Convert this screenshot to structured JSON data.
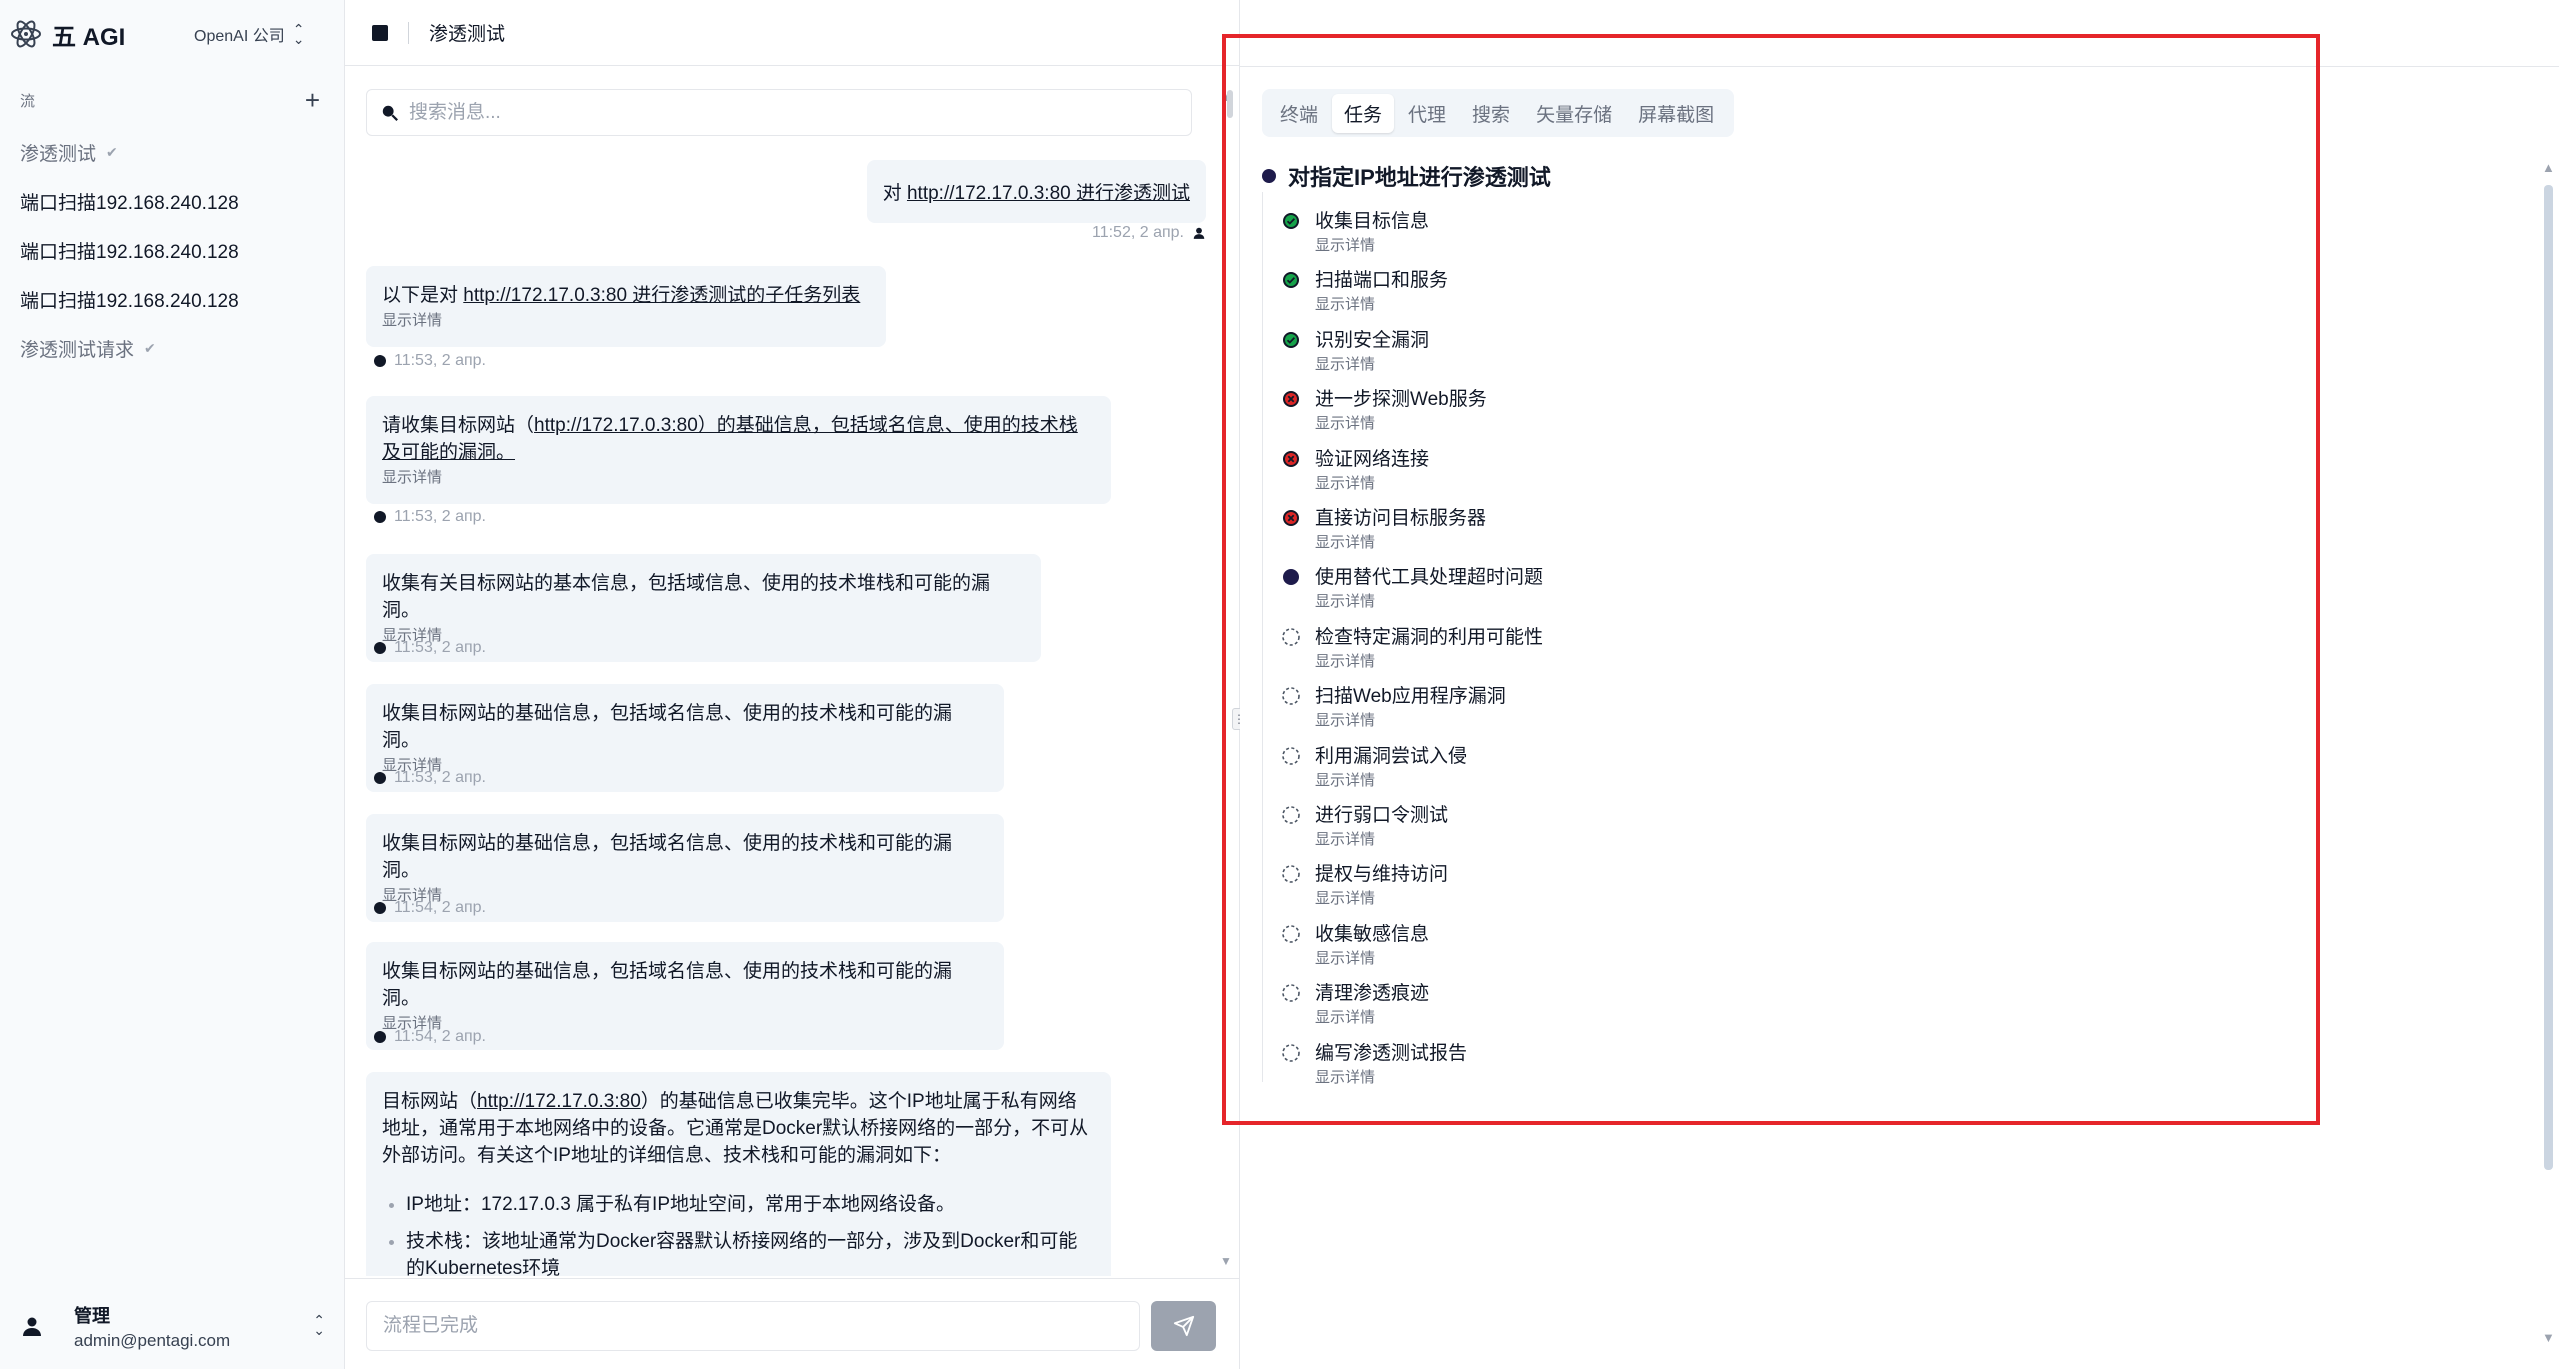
{
  "sidebar": {
    "brand_name": "五 AGI",
    "org_selector": "OpenAI 公司",
    "flows_label": "流",
    "flows": [
      {
        "label": "渗透测试",
        "muted": true
      },
      {
        "label": "端口扫描192.168.240.128",
        "muted": false
      },
      {
        "label": "端口扫描192.168.240.128",
        "muted": false
      },
      {
        "label": "端口扫描192.168.240.128",
        "muted": false
      },
      {
        "label": "渗透测试请求",
        "muted": true
      }
    ],
    "user": {
      "name": "管理",
      "email": "admin@pentagi.com"
    }
  },
  "chat": {
    "title": "渗透测试",
    "search_placeholder": "搜索消息...",
    "user_message": {
      "prefix": "对 ",
      "link": "http://172.17.0.3:80 进行渗透测试",
      "time": "11:52, 2 апр."
    },
    "details_label": "显示详情",
    "messages": [
      {
        "text_prefix": "以下是对 ",
        "link": "http://172.17.0.3:80 进行渗透测试的子任务列表",
        "text_suffix": "",
        "time": "11:53, 2 апр."
      },
      {
        "text_prefix": "请收集目标网站（",
        "link": "http://172.17.0.3:80）的基础信息，包括域名信息、使用的技术栈及可能的漏洞。",
        "text_suffix": "",
        "time": "11:53, 2 апр."
      },
      {
        "text_prefix": "收集有关目标网站的基本信息，包括域信息、使用的技术堆栈和可能的漏洞。",
        "link": "",
        "text_suffix": "",
        "time": "11:53, 2 апр."
      },
      {
        "text_prefix": "收集目标网站的基础信息，包括域名信息、使用的技术栈和可能的漏洞。",
        "link": "",
        "text_suffix": "",
        "time": "11:53, 2 апр."
      },
      {
        "text_prefix": "收集目标网站的基础信息，包括域名信息、使用的技术栈和可能的漏洞。",
        "link": "",
        "text_suffix": "",
        "time": "11:54, 2 апр."
      },
      {
        "text_prefix": "收集目标网站的基础信息，包括域名信息、使用的技术栈和可能的漏洞。",
        "link": "",
        "text_suffix": "",
        "time": "11:54, 2 апр."
      }
    ],
    "final_message": {
      "prefix": "目标网站（",
      "link": "http://172.17.0.3:80",
      "suffix": "）的基础信息已收集完毕。这个IP地址属于私有网络地址，通常用于本地网络中的设备。它通常是Docker默认桥接网络的一部分，不可从外部访问。有关这个IP地址的详细信息、技术栈和可能的漏洞如下：",
      "bullets": [
        "IP地址：172.17.0.3 属于私有IP地址空间，常用于本地网络设备。",
        "技术栈：该地址通常为Docker容器默认桥接网络的一部分，涉及到Docker和可能的Kubernetes环境"
      ]
    },
    "input_placeholder": "流程已完成"
  },
  "right_panel": {
    "tabs": [
      "终端",
      "任务",
      "代理",
      "搜索",
      "矢量存储",
      "屏幕截图"
    ],
    "active_tab": "任务",
    "root_task": "对指定IP地址进行渗透测试",
    "details_label": "显示详情",
    "tasks": [
      {
        "label": "收集目标信息",
        "status": "done"
      },
      {
        "label": "扫描端口和服务",
        "status": "done"
      },
      {
        "label": "识别安全漏洞",
        "status": "done"
      },
      {
        "label": "进一步探测Web服务",
        "status": "failed"
      },
      {
        "label": "验证网络连接",
        "status": "failed"
      },
      {
        "label": "直接访问目标服务器",
        "status": "failed"
      },
      {
        "label": "使用替代工具处理超时问题",
        "status": "running"
      },
      {
        "label": "检查特定漏洞的利用可能性",
        "status": "pending"
      },
      {
        "label": "扫描Web应用程序漏洞",
        "status": "pending"
      },
      {
        "label": "利用漏洞尝试入侵",
        "status": "pending"
      },
      {
        "label": "进行弱口令测试",
        "status": "pending"
      },
      {
        "label": "提权与维持访问",
        "status": "pending"
      },
      {
        "label": "收集敏感信息",
        "status": "pending"
      },
      {
        "label": "清理渗透痕迹",
        "status": "pending"
      },
      {
        "label": "编写渗透测试报告",
        "status": "pending"
      }
    ]
  },
  "colors": {
    "done": "#16a34a",
    "failed": "#dc2626",
    "running": "#1e1b4b",
    "highlight": "#e5252a"
  },
  "icons": [
    "atom-logo-icon",
    "updown-icon",
    "plus-icon",
    "check-icon",
    "stop-icon",
    "search-icon",
    "send-icon",
    "user-icon",
    "status-done-icon",
    "status-failed-icon",
    "status-running-icon",
    "status-pending-icon"
  ]
}
